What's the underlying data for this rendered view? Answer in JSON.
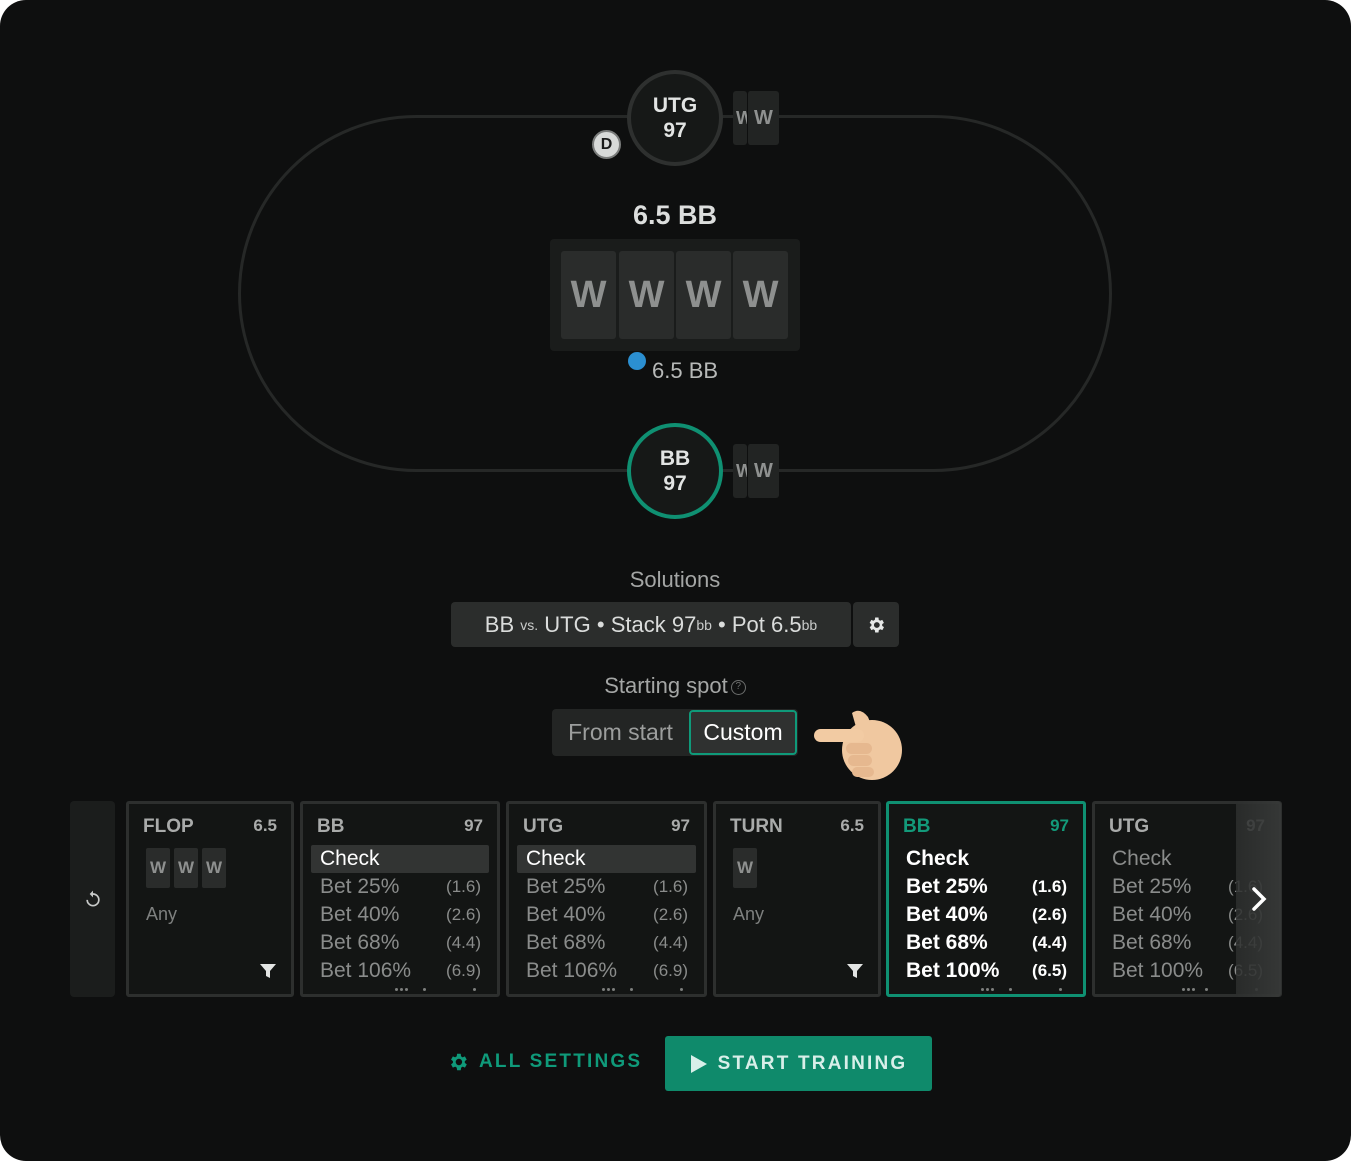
{
  "colors": {
    "background": "#0e0f0f",
    "accent": "#0f9072",
    "button_primary": "#0f8a6b",
    "chip_blue": "#2b8fd1",
    "chip_red": "#c0393b"
  },
  "table": {
    "seats": {
      "utg": {
        "position": "UTG",
        "stack": "97",
        "card_back": "W",
        "card_front": "W"
      },
      "bb": {
        "position": "BB",
        "stack": "97",
        "card_back": "W",
        "card_front": "W"
      }
    },
    "dealer_button": "D",
    "pot": "6.5 BB",
    "board": [
      "W",
      "W",
      "W",
      "W"
    ],
    "chips_amount": "6.5 BB"
  },
  "solutions": {
    "label": "Solutions",
    "hero": "BB",
    "vs": "vs.",
    "villain": "UTG",
    "sep": "•",
    "stack_label": "Stack",
    "stack_value": "97",
    "pot_label": "Pot",
    "pot_value": "6.5",
    "unit": "bb",
    "settings_icon": "gear-icon"
  },
  "starting_spot": {
    "label": "Starting spot",
    "help_icon": "?",
    "options": [
      "From start",
      "Custom"
    ],
    "selected": "Custom"
  },
  "strip": {
    "reset_icon": "reset-icon",
    "nodes": [
      {
        "kind": "street",
        "title": "FLOP",
        "value": "6.5",
        "cards": [
          "W",
          "W",
          "W"
        ],
        "range": "Any"
      },
      {
        "kind": "player",
        "title": "BB",
        "value": "97",
        "actions": [
          {
            "label": "Check",
            "size": ""
          },
          {
            "label": "Bet 25%",
            "size": "(1.6)"
          },
          {
            "label": "Bet 40%",
            "size": "(2.6)"
          },
          {
            "label": "Bet 68%",
            "size": "(4.4)"
          },
          {
            "label": "Bet 106%",
            "size": "(6.9)"
          }
        ],
        "highlight": 0
      },
      {
        "kind": "player",
        "title": "UTG",
        "value": "97",
        "actions": [
          {
            "label": "Check",
            "size": ""
          },
          {
            "label": "Bet 25%",
            "size": "(1.6)"
          },
          {
            "label": "Bet 40%",
            "size": "(2.6)"
          },
          {
            "label": "Bet 68%",
            "size": "(4.4)"
          },
          {
            "label": "Bet 106%",
            "size": "(6.9)"
          }
        ],
        "highlight": 0
      },
      {
        "kind": "street",
        "title": "TURN",
        "value": "6.5",
        "cards": [
          "W"
        ],
        "range": "Any"
      },
      {
        "kind": "player",
        "title": "BB",
        "value": "97",
        "selected": true,
        "actions": [
          {
            "label": "Check",
            "size": ""
          },
          {
            "label": "Bet 25%",
            "size": "(1.6)"
          },
          {
            "label": "Bet 40%",
            "size": "(2.6)"
          },
          {
            "label": "Bet 68%",
            "size": "(4.4)"
          },
          {
            "label": "Bet 100%",
            "size": "(6.5)"
          }
        ],
        "highlight": -1
      },
      {
        "kind": "player",
        "title": "UTG",
        "value": "97",
        "actions": [
          {
            "label": "Check",
            "size": ""
          },
          {
            "label": "Bet 25%",
            "size": "(1.6)"
          },
          {
            "label": "Bet 40%",
            "size": "(2.6)"
          },
          {
            "label": "Bet 68%",
            "size": "(4.4)"
          },
          {
            "label": "Bet 100%",
            "size": "(6.5)"
          }
        ],
        "highlight": -1
      }
    ],
    "next_icon": "chevron-right-icon"
  },
  "footer": {
    "all_settings": "ALL SETTINGS",
    "start_training": "START TRAINING"
  }
}
